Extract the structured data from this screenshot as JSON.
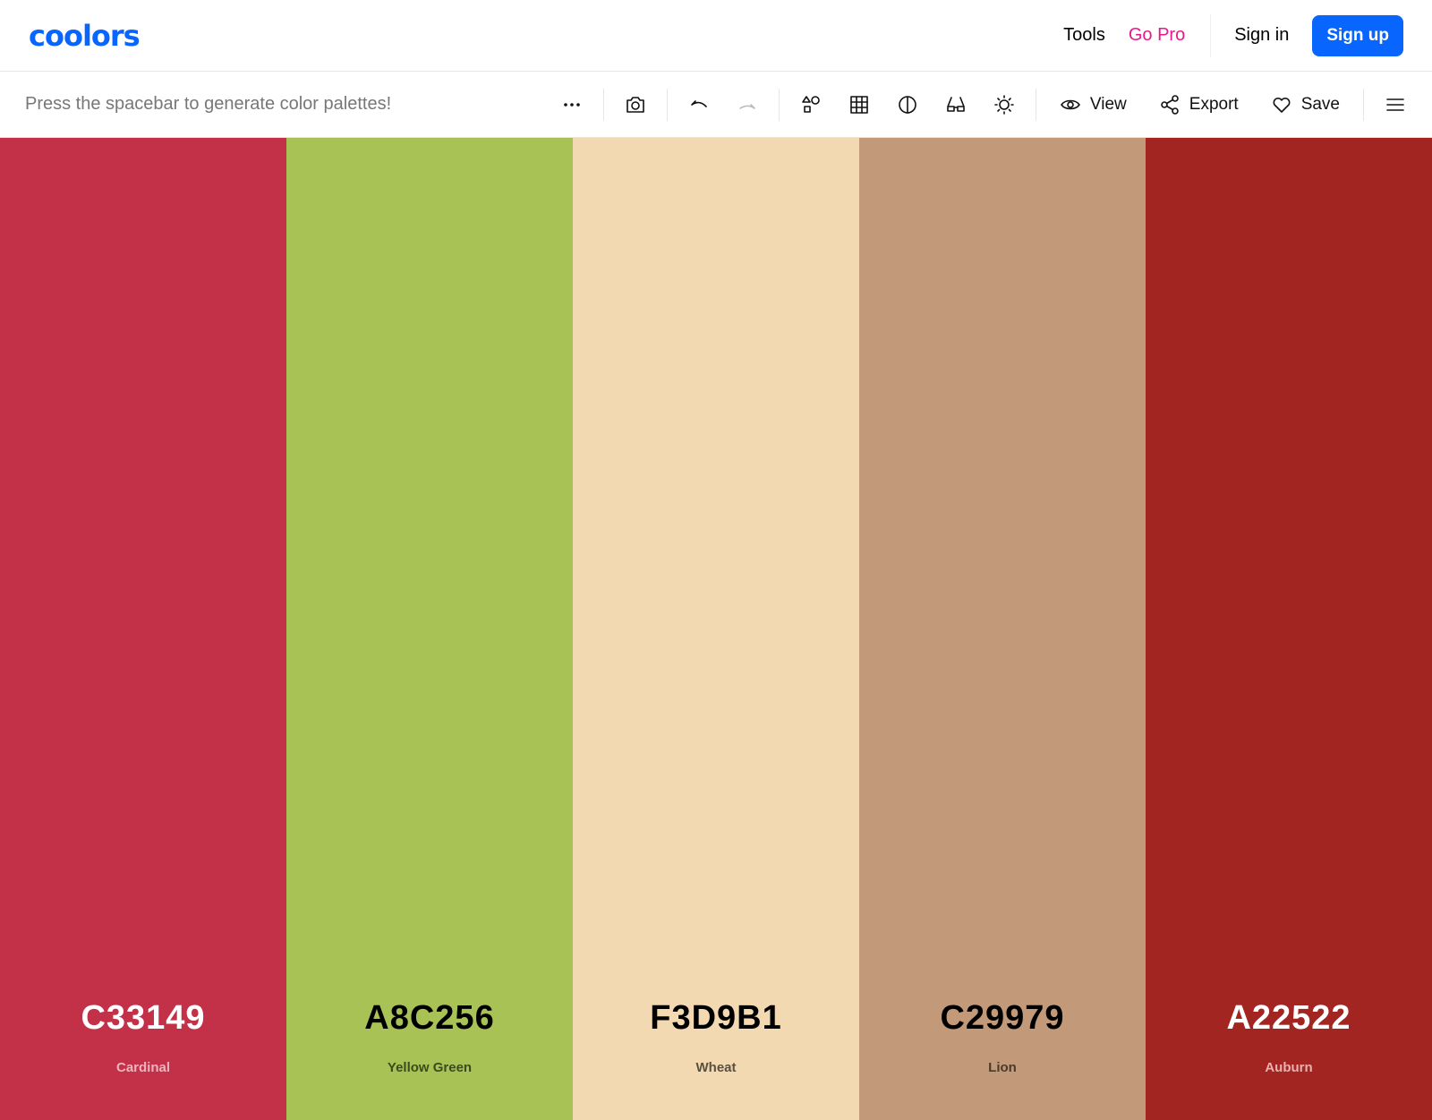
{
  "header": {
    "logo": "coolors",
    "tools": "Tools",
    "go_pro": "Go Pro",
    "sign_in": "Sign in",
    "sign_up": "Sign up"
  },
  "toolbar": {
    "hint": "Press the spacebar to generate color palettes!",
    "view": "View",
    "export": "Export",
    "save": "Save"
  },
  "colors": [
    {
      "hex": "C33149",
      "name": "Cardinal",
      "bg": "#C33149",
      "fg": "#ffffff",
      "sub": "#f0b3bd"
    },
    {
      "hex": "A8C256",
      "name": "Yellow Green",
      "bg": "#A8C256",
      "fg": "#000000",
      "sub": "#3e4a1c"
    },
    {
      "hex": "F3D9B1",
      "name": "Wheat",
      "bg": "#F3D9B1",
      "fg": "#000000",
      "sub": "#5a5040"
    },
    {
      "hex": "C29979",
      "name": "Lion",
      "bg": "#C29979",
      "fg": "#000000",
      "sub": "#4a3a2c"
    },
    {
      "hex": "A22522",
      "name": "Auburn",
      "bg": "#A22522",
      "fg": "#ffffff",
      "sub": "#e8b0ae"
    }
  ]
}
